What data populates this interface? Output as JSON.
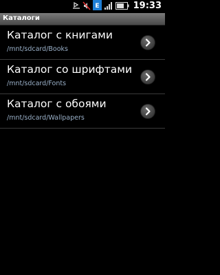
{
  "status_bar": {
    "time": "19:33",
    "icons": [
      "usb-debug-icon",
      "mute-icon",
      "data-sync-icon",
      "signal-icon",
      "battery-icon"
    ]
  },
  "title_bar": {
    "title": "Каталоги"
  },
  "catalogs": [
    {
      "name": "Каталог с книгами",
      "path": "/mnt/sdcard/Books"
    },
    {
      "name": "Каталог со шрифтами",
      "path": "/mnt/sdcard/Fonts"
    },
    {
      "name": "Каталог с обоями",
      "path": "/mnt/sdcard/Wallpapers"
    }
  ],
  "colors": {
    "background": "#000000",
    "title_bar": "#5a5a5a",
    "path_text": "#9ab0c8",
    "divider": "#3a3a3a"
  }
}
